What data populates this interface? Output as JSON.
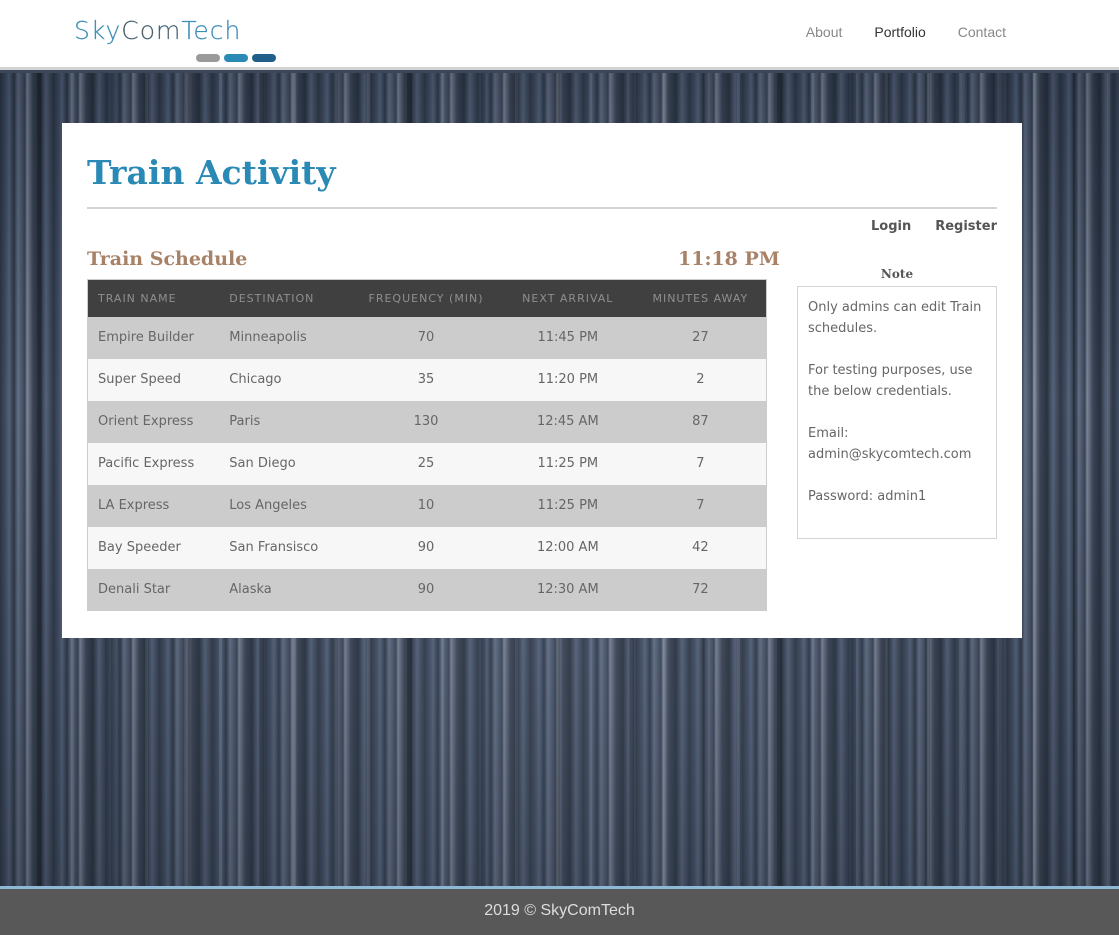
{
  "header": {
    "logo": {
      "part1": "Sky",
      "part2": "Com",
      "part3": "Tech"
    },
    "logo_colors": [
      "#9a9a9a",
      "#2a8ab5",
      "#1f5f8a"
    ],
    "nav": [
      {
        "label": "About"
      },
      {
        "label": "Portfolio"
      },
      {
        "label": "Contact"
      }
    ]
  },
  "main": {
    "title": "Train Activity",
    "auth": {
      "login": "Login",
      "register": "Register"
    },
    "schedule_title": "Train Schedule",
    "current_time": "11:18 PM",
    "table": {
      "headers": [
        "Train Name",
        "Destination",
        "Frequency (min)",
        "Next Arrival",
        "Minutes Away"
      ],
      "rows": [
        [
          "Empire Builder",
          "Minneapolis",
          "70",
          "11:45 PM",
          "27"
        ],
        [
          "Super Speed",
          "Chicago",
          "35",
          "11:20 PM",
          "2"
        ],
        [
          "Orient Express",
          "Paris",
          "130",
          "12:45 AM",
          "87"
        ],
        [
          "Pacific Express",
          "San Diego",
          "25",
          "11:25 PM",
          "7"
        ],
        [
          "LA Express",
          "Los Angeles",
          "10",
          "11:25 PM",
          "7"
        ],
        [
          "Bay Speeder",
          "San Fransisco",
          "90",
          "12:00 AM",
          "42"
        ],
        [
          "Denali Star",
          "Alaska",
          "90",
          "12:30 AM",
          "72"
        ]
      ]
    },
    "note": {
      "label": "Note",
      "lines": [
        "Only admins can edit Train schedules.",
        "For testing purposes, use the below credentials.",
        "Email: admin@skycomtech.com",
        "Password: admin1"
      ]
    }
  },
  "footer": {
    "text": "2019 © SkyComTech"
  },
  "colors": {
    "title": "#2a8ab5",
    "schedule_accent": "#a88267",
    "table_header_bg": "#404040",
    "footer_bg": "#585858"
  }
}
